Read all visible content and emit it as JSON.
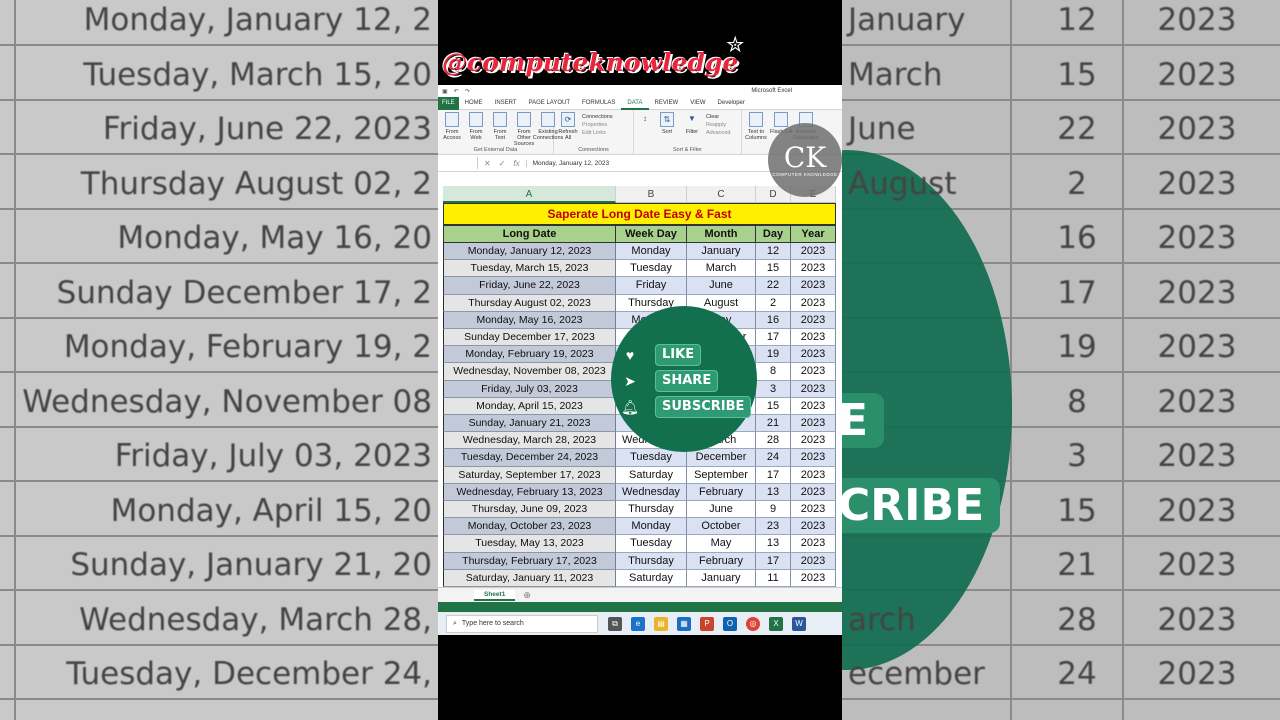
{
  "watermark": "@computeknowledge",
  "excel": {
    "title": "Microsoft Excel",
    "tabs": [
      "FILE",
      "HOME",
      "INSERT",
      "PAGE LAYOUT",
      "FORMULAS",
      "DATA",
      "REVIEW",
      "VIEW",
      "Developer"
    ],
    "active_tab": "DATA",
    "ribbon": {
      "external": {
        "buttons": [
          "From Access",
          "From Web",
          "From Text",
          "From Other Sources",
          "Existing Connections"
        ],
        "label": "Get External Data"
      },
      "connections": {
        "refresh": "Refresh All",
        "items": [
          "Connections",
          "Properties",
          "Edit Links"
        ],
        "label": "Connections"
      },
      "sortfilter": {
        "sort": "Sort",
        "filter": "Filter",
        "items": [
          "Clear",
          "Reapply",
          "Advanced"
        ],
        "label": "Sort & Filter"
      },
      "tools": [
        "Text to Columns",
        "Flash Fill",
        "Remove Duplicates"
      ]
    },
    "logo": {
      "initials": "CK",
      "text": "COMPUTER KNOWLEDGE"
    },
    "formula_bar": {
      "name_box": "",
      "value": "Monday, January 12, 2023"
    },
    "columns": [
      "A",
      "B",
      "C",
      "D",
      "E"
    ],
    "sheet_title": "Saperate Long Date Easy & Fast",
    "headers": [
      "Long Date",
      "Week Day",
      "Month",
      "Day",
      "Year"
    ],
    "rows": [
      [
        "Monday, January 12, 2023",
        "Monday",
        "January",
        "12",
        "2023"
      ],
      [
        "Tuesday, March 15, 2023",
        "Tuesday",
        "March",
        "15",
        "2023"
      ],
      [
        "Friday, June 22, 2023",
        "Friday",
        "June",
        "22",
        "2023"
      ],
      [
        "Thursday August 02, 2023",
        "Thursday",
        "August",
        "2",
        "2023"
      ],
      [
        "Monday, May 16, 2023",
        "Monday",
        "May",
        "16",
        "2023"
      ],
      [
        "Sunday December 17, 2023",
        "Sunday",
        "December",
        "17",
        "2023"
      ],
      [
        "Monday, February 19, 2023",
        "Monday",
        "February",
        "19",
        "2023"
      ],
      [
        "Wednesday, November 08, 2023",
        "Wednesday",
        "November",
        "8",
        "2023"
      ],
      [
        "Friday, July 03, 2023",
        "Friday",
        "July",
        "3",
        "2023"
      ],
      [
        "Monday, April 15, 2023",
        "Monday",
        "April",
        "15",
        "2023"
      ],
      [
        "Sunday, January 21, 2023",
        "Sunday",
        "January",
        "21",
        "2023"
      ],
      [
        "Wednesday, March 28, 2023",
        "Wednesday",
        "March",
        "28",
        "2023"
      ],
      [
        "Tuesday, December 24, 2023",
        "Tuesday",
        "December",
        "24",
        "2023"
      ],
      [
        "Saturday, September 17, 2023",
        "Saturday",
        "September",
        "17",
        "2023"
      ],
      [
        "Wednesday, February 13, 2023",
        "Wednesday",
        "February",
        "13",
        "2023"
      ],
      [
        "Thursday, June 09, 2023",
        "Thursday",
        "June",
        "9",
        "2023"
      ],
      [
        "Monday, October 23, 2023",
        "Monday",
        "October",
        "23",
        "2023"
      ],
      [
        "Tuesday, May 13, 2023",
        "Tuesday",
        "May",
        "13",
        "2023"
      ],
      [
        "Thursday, February 17, 2023",
        "Thursday",
        "February",
        "17",
        "2023"
      ],
      [
        "Saturday, January 11, 2023",
        "Saturday",
        "January",
        "11",
        "2023"
      ]
    ],
    "sheet_tab": "Sheet1",
    "taskbar": {
      "search_placeholder": "Type here to search"
    }
  },
  "overlay": {
    "like": "LIKE",
    "share": "SHARE",
    "subscribe": "SUBSCRIBE"
  },
  "background": {
    "left_dates": [
      "Monday, January 12, 2",
      "Tuesday, March 15, 20",
      "Friday, June 22, 2023",
      "Thursday August 02, 2",
      "Monday, May 16, 20",
      "Sunday December 17, 2",
      "Monday, February 19, 2",
      "Wednesday, November 08",
      "Friday, July 03, 2023",
      "Monday, April 15, 20",
      "Sunday, January 21, 20",
      "Wednesday, March 28,",
      "Tuesday, December 24,"
    ],
    "right_months": [
      "January",
      "March",
      "June",
      "August",
      "",
      "",
      "",
      "",
      "",
      "",
      "",
      "arch",
      "ecember"
    ],
    "right_days": [
      "12",
      "15",
      "22",
      "2",
      "16",
      "17",
      "19",
      "8",
      "3",
      "15",
      "21",
      "28",
      "24"
    ],
    "right_years": [
      "2023",
      "2023",
      "2023",
      "2023",
      "2023",
      "2023",
      "2023",
      "2023",
      "2023",
      "2023",
      "2023",
      "2023",
      "2023"
    ]
  },
  "colors": {
    "excel_green": "#217346",
    "header_green": "#a9d18e",
    "title_yellow": "#ffef00",
    "title_red": "#c00000",
    "row_blue": "#d9e1f2",
    "overlay_green": "#13704f"
  }
}
